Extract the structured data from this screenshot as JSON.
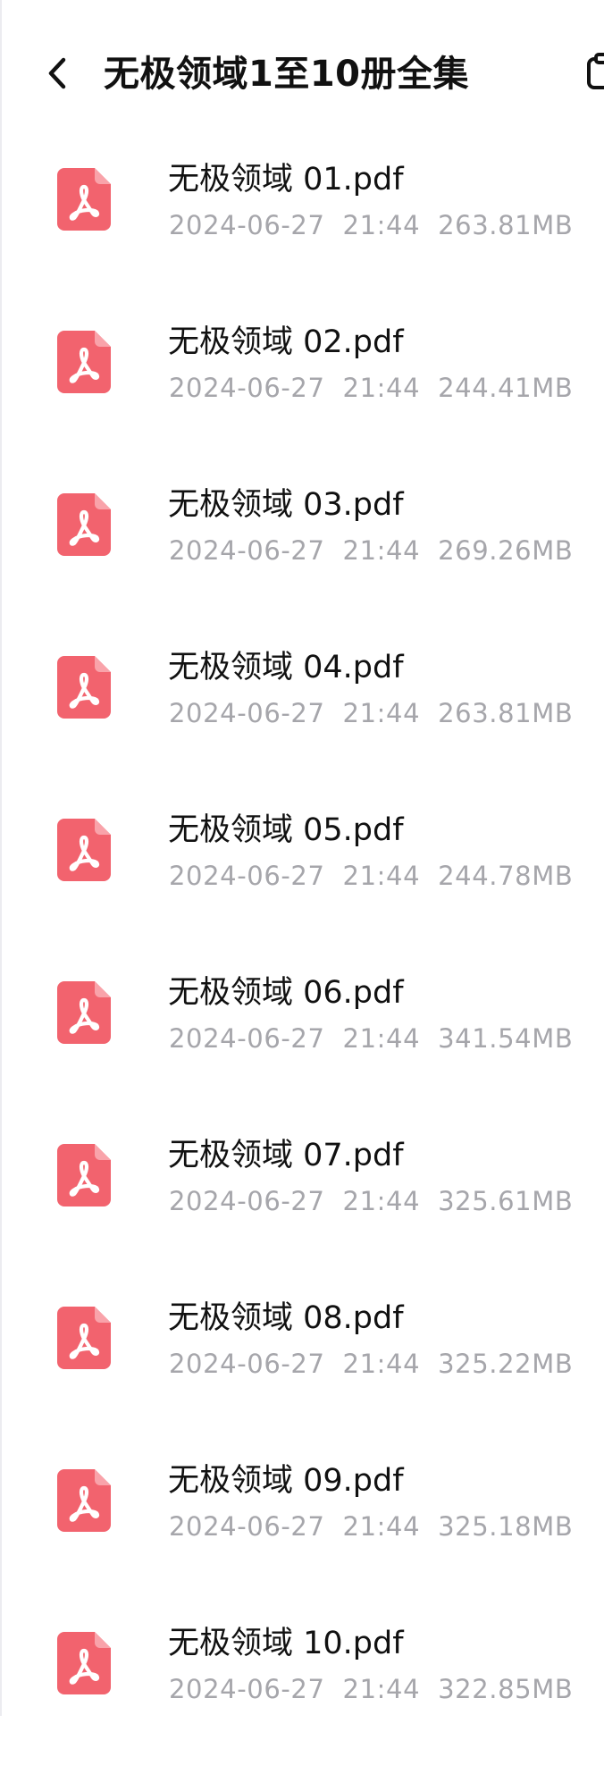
{
  "header": {
    "title": "无极领域1至10册全集",
    "back_icon": "chevron-left-icon",
    "right_icon": "clipboard-icon"
  },
  "files": [
    {
      "name": "无极领域 01.pdf",
      "date": "2024-06-27",
      "time": "21:44",
      "size": "263.81MB"
    },
    {
      "name": "无极领域 02.pdf",
      "date": "2024-06-27",
      "time": "21:44",
      "size": "244.41MB"
    },
    {
      "name": "无极领域 03.pdf",
      "date": "2024-06-27",
      "time": "21:44",
      "size": "269.26MB"
    },
    {
      "name": "无极领域 04.pdf",
      "date": "2024-06-27",
      "time": "21:44",
      "size": "263.81MB"
    },
    {
      "name": "无极领域 05.pdf",
      "date": "2024-06-27",
      "time": "21:44",
      "size": "244.78MB"
    },
    {
      "name": "无极领域 06.pdf",
      "date": "2024-06-27",
      "time": "21:44",
      "size": "341.54MB"
    },
    {
      "name": "无极领域 07.pdf",
      "date": "2024-06-27",
      "time": "21:44",
      "size": "325.61MB"
    },
    {
      "name": "无极领域 08.pdf",
      "date": "2024-06-27",
      "time": "21:44",
      "size": "325.22MB"
    },
    {
      "name": "无极领域 09.pdf",
      "date": "2024-06-27",
      "time": "21:44",
      "size": "325.18MB"
    },
    {
      "name": "无极领域 10.pdf",
      "date": "2024-06-27",
      "time": "21:44",
      "size": "322.85MB"
    }
  ],
  "colors": {
    "pdf_icon": "#f2636e",
    "meta_text": "#a6a6ab",
    "title_text": "#111111"
  }
}
